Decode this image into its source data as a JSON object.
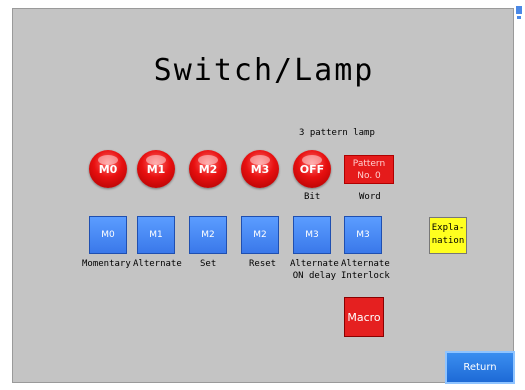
{
  "title": "Switch/Lamp",
  "pattern_caption": "3 pattern lamp",
  "lamps": [
    {
      "label": "M0"
    },
    {
      "label": "M1"
    },
    {
      "label": "M2"
    },
    {
      "label": "M3"
    },
    {
      "label": "OFF"
    }
  ],
  "bit_caption": "Bit",
  "word_lamp": {
    "line1": "Pattern",
    "line2": "No. 0"
  },
  "word_caption": "Word",
  "buttons": [
    {
      "label": "M0",
      "caption": "Momentary"
    },
    {
      "label": "M1",
      "caption": "Alternate"
    },
    {
      "label": "M2",
      "caption": "Set"
    },
    {
      "label": "M2",
      "caption": "Reset"
    },
    {
      "label": "M3",
      "caption_line1": "Alternate",
      "caption_line2": "ON delay"
    },
    {
      "label": "M3",
      "caption_line1": "Alternate",
      "caption_line2": "Interlock"
    }
  ],
  "explanation": {
    "line1": "Expla-",
    "line2": "nation"
  },
  "macro_label": "Macro",
  "return_label": "Return",
  "colors": {
    "lamp_red": "#e81010",
    "button_blue": "#3a78ea",
    "explanation_yellow": "#ffff1f",
    "background": "#c4c4c4"
  }
}
